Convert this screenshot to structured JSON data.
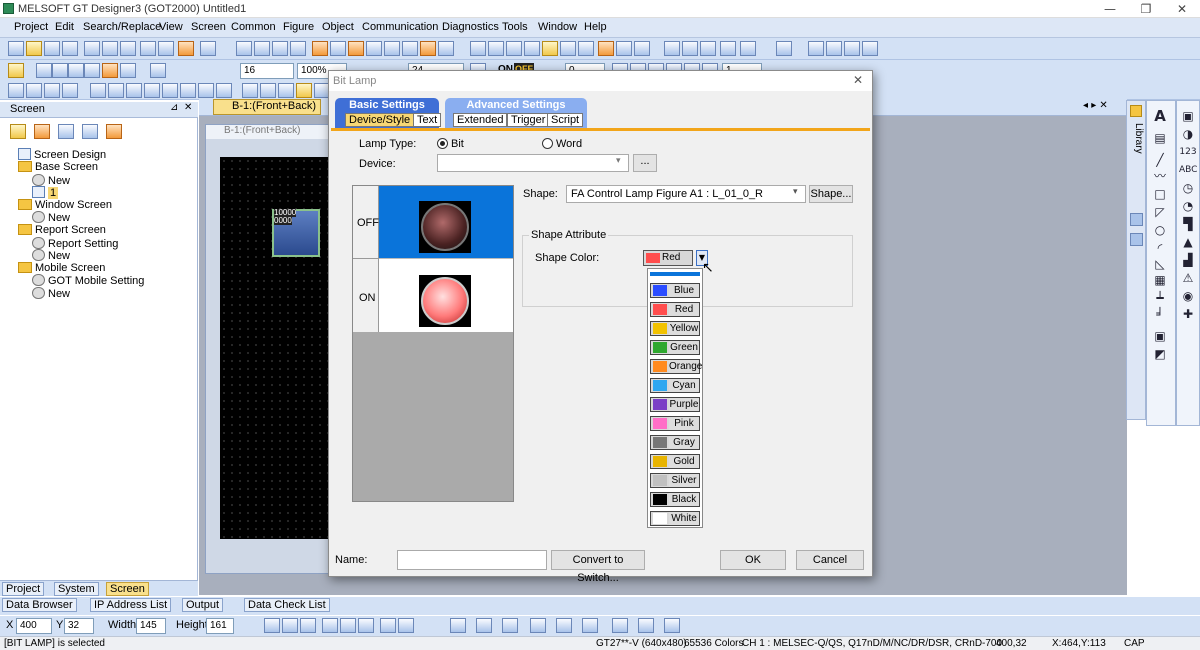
{
  "window": {
    "title": "MELSOFT GT Designer3 (GOT2000) Untitled1",
    "minimize": "—",
    "restore": "❐",
    "close": "✕"
  },
  "menu": [
    "Project",
    "Edit",
    "Search/Replace",
    "View",
    "Screen",
    "Common",
    "Figure",
    "Object",
    "Communication",
    "Diagnostics",
    "Tools",
    "Window",
    "Help"
  ],
  "toolbar2": {
    "font_size": "16",
    "zoom": "100%",
    "text_size": "24",
    "on_label": "ON",
    "off_label": "OFF",
    "num0": "0",
    "num1": "1"
  },
  "screen_panel": {
    "title": "Screen",
    "tree": [
      {
        "label": "Screen Design",
        "type": "doc",
        "level": 0
      },
      {
        "label": "Base Screen",
        "type": "folder",
        "level": 0
      },
      {
        "label": "New",
        "type": "gear",
        "level": 1
      },
      {
        "label": "1",
        "type": "doc",
        "level": 1,
        "selected": true
      },
      {
        "label": "Window Screen",
        "type": "folder",
        "level": 0
      },
      {
        "label": "New",
        "type": "gear",
        "level": 1
      },
      {
        "label": "Report Screen",
        "type": "folder",
        "level": 0
      },
      {
        "label": "Report Setting",
        "type": "gear",
        "level": 1
      },
      {
        "label": "New",
        "type": "gear",
        "level": 1
      },
      {
        "label": "Mobile Screen",
        "type": "folder",
        "level": 0
      },
      {
        "label": "GOT Mobile Setting",
        "type": "gear",
        "level": 1
      },
      {
        "label": "New",
        "type": "gear",
        "level": 1
      }
    ],
    "tabs": [
      "Project",
      "System",
      "Screen"
    ]
  },
  "editor": {
    "tab_label": "B-1:(Front+Back)",
    "inner_title": "B-1:(Front+Back)",
    "lamp_text1": "10000",
    "lamp_text2": "0000"
  },
  "right_panel": {
    "library_label": "Library"
  },
  "bottom_bar": {
    "items": [
      "Data Browser",
      "IP Address List",
      "Output",
      "Data Check List"
    ]
  },
  "coord_bar": {
    "x_label": "X",
    "x": "400",
    "y_label": "Y",
    "y": "32",
    "width_label": "Width",
    "width": "145",
    "height_label": "Height",
    "height": "161"
  },
  "status": {
    "left": "[BIT LAMP] is selected",
    "model": "GT27**-V (640x480)",
    "colors": "65536 Colors",
    "channel": "CH 1 : MELSEC-Q/QS, Q17nD/M/NC/DR/DSR, CRnD-700",
    "pos": "400,32",
    "cursor": "X:464,Y:113",
    "caps": "CAP"
  },
  "dialog": {
    "title": "Bit Lamp",
    "close": "✕",
    "tab_basic": "Basic Settings",
    "tab_advanced": "Advanced Settings",
    "subtabs_basic": [
      "Device/Style",
      "Text"
    ],
    "subtabs_advanced": [
      "Extended",
      "Trigger",
      "Script"
    ],
    "lamp_type_label": "Lamp Type:",
    "opt_bit": "Bit",
    "opt_word": "Word",
    "device_label": "Device:",
    "device_value": "",
    "browse_button": "...",
    "state_off": "OFF",
    "state_on": "ON",
    "shape_label": "Shape:",
    "shape_value": "FA Control Lamp Figure A1 : L_01_0_R",
    "shape_button": "Shape...",
    "shape_attr_label": "Shape Attribute",
    "shape_color_label": "Shape Color:",
    "shape_color_value": "Red",
    "name_label": "Name:",
    "name_value": "",
    "convert_button": "Convert to Switch...",
    "ok_button": "OK",
    "cancel_button": "Cancel"
  },
  "color_options": [
    {
      "label": "Blue",
      "color": "#2a4cff"
    },
    {
      "label": "Red",
      "color": "#ff4d4d"
    },
    {
      "label": "Yellow",
      "color": "#f2c200"
    },
    {
      "label": "Green",
      "color": "#2fa82f"
    },
    {
      "label": "Orange",
      "color": "#ff8a1f"
    },
    {
      "label": "Cyan",
      "color": "#2ea7f0"
    },
    {
      "label": "Purple",
      "color": "#7b3fc6"
    },
    {
      "label": "Pink",
      "color": "#ff6ec7"
    },
    {
      "label": "Gray",
      "color": "#777777"
    },
    {
      "label": "Gold",
      "color": "#e8b400"
    },
    {
      "label": "Silver",
      "color": "#c0c0c0"
    },
    {
      "label": "Black",
      "color": "#000000"
    },
    {
      "label": "White",
      "color": "#ffffff"
    }
  ]
}
